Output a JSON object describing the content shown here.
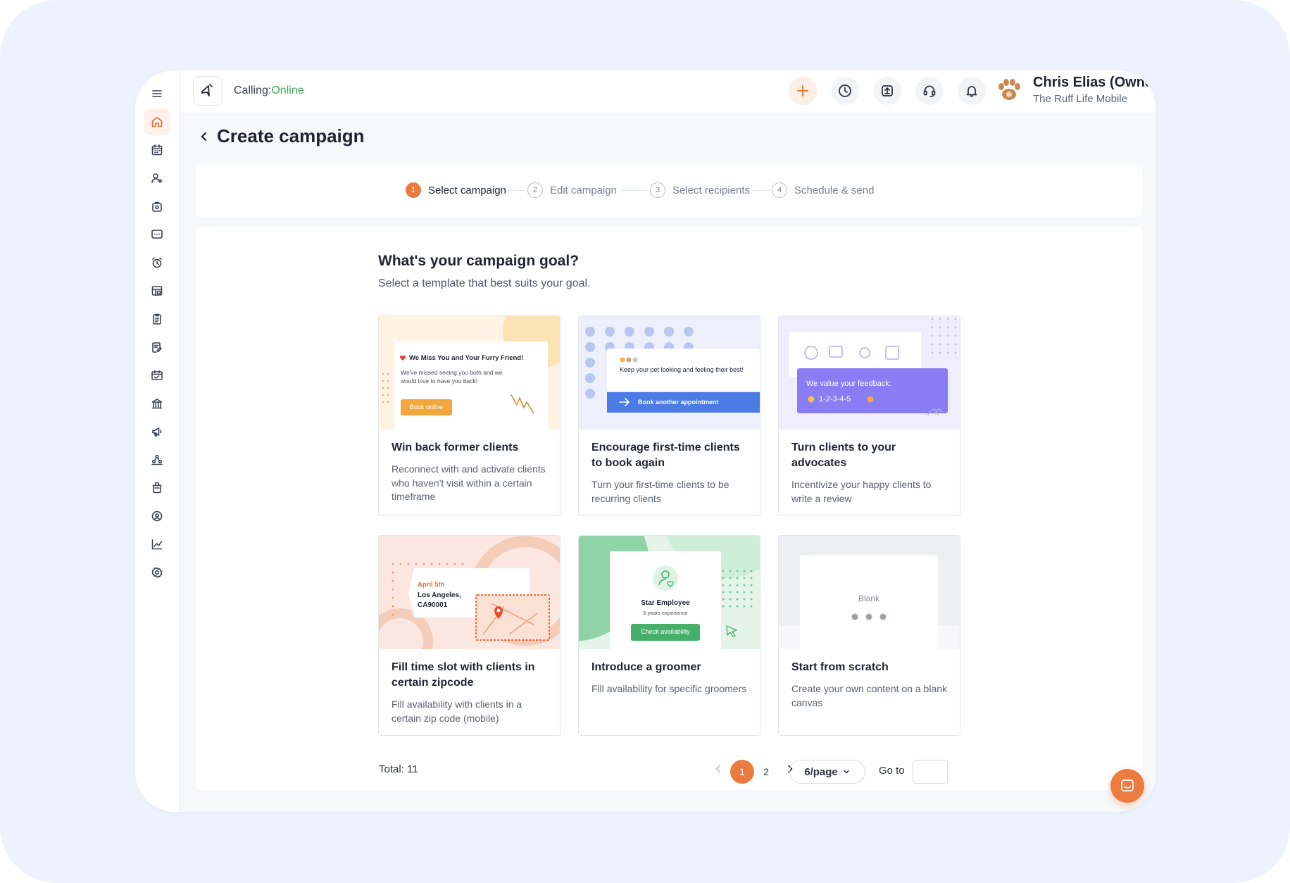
{
  "topbar": {
    "calling_label": "Calling:",
    "calling_status": "Online",
    "user_name": "Chris Elias (Owner)",
    "user_org": "The Ruff Life Mobile"
  },
  "page": {
    "title": "Create campaign"
  },
  "steps": [
    {
      "num": "1",
      "label": "Select campaign"
    },
    {
      "num": "2",
      "label": "Edit campaign"
    },
    {
      "num": "3",
      "label": "Select recipients"
    },
    {
      "num": "4",
      "label": "Schedule & send"
    }
  ],
  "goal": {
    "title": "What's your campaign goal?",
    "subtitle": "Select a template that best suits your goal."
  },
  "templates": [
    {
      "title": "Win back former clients",
      "desc": "Reconnect with and activate clients who haven't visit within a certain timeframe",
      "thumb": {
        "heading": "We Miss You and Your Furry Friend!",
        "body": "We've missed seeing you both and we would love to have you back!",
        "button": "Book online"
      }
    },
    {
      "title": "Encourage first-time clients to book again",
      "desc": "Turn your first-time clients to be recurring clients",
      "thumb": {
        "body": "Keep your pet looking and feeling their best!",
        "button": "Book another appointment"
      }
    },
    {
      "title": "Turn clients to your advocates",
      "desc": "Incentivize your happy clients to write a review",
      "thumb": {
        "heading": "We value your feedback:",
        "scale": "1-2-3-4-5"
      }
    },
    {
      "title": "Fill time slot with clients in certain zipcode",
      "desc": "Fill availability with clients in a certain zip code (mobile)",
      "thumb": {
        "date": "April 5th",
        "city": "Los Angeles,",
        "zip": "CA90001"
      }
    },
    {
      "title": "Introduce a groomer",
      "desc": "Fill availability for specific groomers",
      "thumb": {
        "name": "Star Employee",
        "experience": "5 years experience",
        "button": "Check availability"
      }
    },
    {
      "title": "Start from scratch",
      "desc": "Create your own content on a blank canvas",
      "thumb": {
        "label": "Blank"
      }
    }
  ],
  "pagination": {
    "total": "Total: 11",
    "pages": [
      "1",
      "2"
    ],
    "current": "1",
    "page_size": "6/page",
    "goto_label": "Go to"
  },
  "colors": {
    "accent": "#ec7b3f",
    "online": "#46a35a",
    "purple": "#8a7cf3",
    "blue": "#4b7be5",
    "green": "#46b06b"
  },
  "icons": {
    "sidebar": [
      "menu-icon",
      "home-icon",
      "calendar-icon",
      "clients-icon",
      "pets-icon",
      "messages-icon",
      "reminders-icon",
      "bookings-icon",
      "checklist-icon",
      "notes-icon",
      "payments-icon",
      "finance-icon",
      "campaigns-icon",
      "staff-icon",
      "retail-icon",
      "rewards-icon",
      "reports-icon",
      "settings-icon"
    ],
    "topbar": [
      "plus-icon",
      "clock-icon",
      "upload-icon",
      "headset-icon",
      "bell-icon",
      "chevron-down-icon"
    ]
  }
}
